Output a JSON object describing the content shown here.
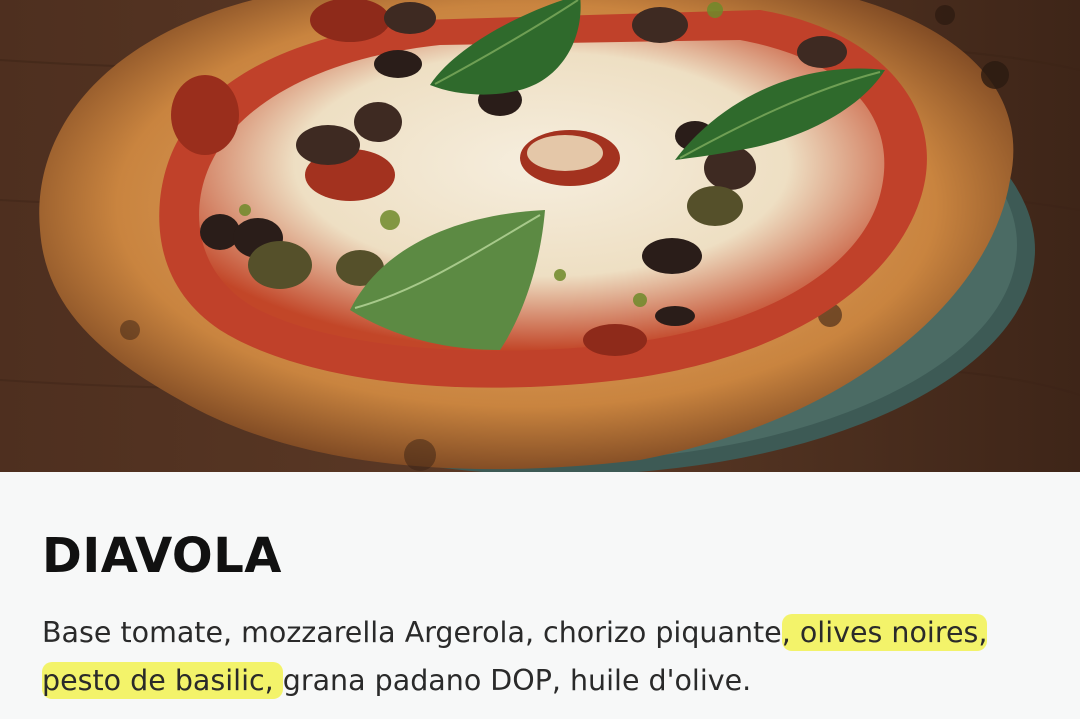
{
  "pizza": {
    "name": "DIAVOLA",
    "description": {
      "before_highlight": "Base tomate, mozzarella Argerola, chorizo piquante",
      "highlighted": ", olives noires, pesto de basilic, ",
      "after_highlight": "grana padano DOP, huile d'olive."
    },
    "image_subject": "diavola-pizza-photo"
  },
  "colors": {
    "highlight": "#f3f36a",
    "background": "#f7f8f8",
    "title_text": "#111111",
    "body_text": "#2a2a2a"
  }
}
